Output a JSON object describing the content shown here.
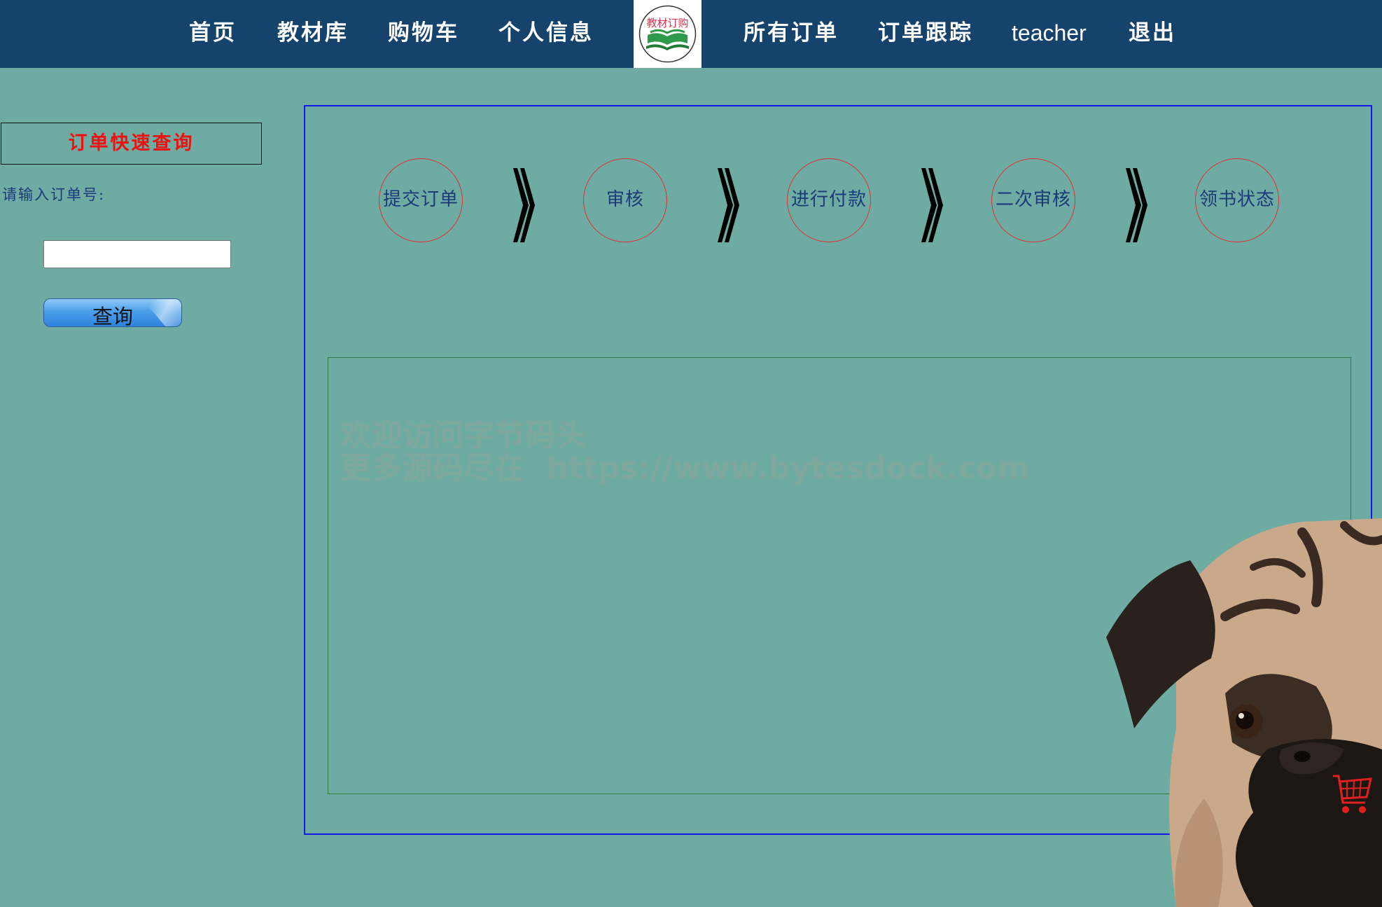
{
  "nav": {
    "items": [
      "首页",
      "教材库",
      "购物车",
      "个人信息",
      "所有订单",
      "订单跟踪",
      "teacher",
      "退出"
    ],
    "logo_text": "教材订购"
  },
  "quick_search": {
    "title": "订单快速查询",
    "label": "请输入订单号:",
    "input_value": "",
    "button_label": "查询"
  },
  "steps": [
    "提交订单",
    "审核",
    "进行付款",
    "二次审核",
    "领书状态"
  ],
  "watermark": {
    "line1": "欢迎访问字节码头",
    "line2": "更多源码尽在  https://www.bytesdock.com"
  },
  "colors": {
    "nav_bg": "#15436b",
    "page_bg": "#6eaba2",
    "panel_border": "#1616ee",
    "step_circle": "#e03030",
    "title_red": "#f01010"
  },
  "icons": [
    "book-logo-icon",
    "double-chevron-right-icon",
    "shopping-cart-icon"
  ]
}
